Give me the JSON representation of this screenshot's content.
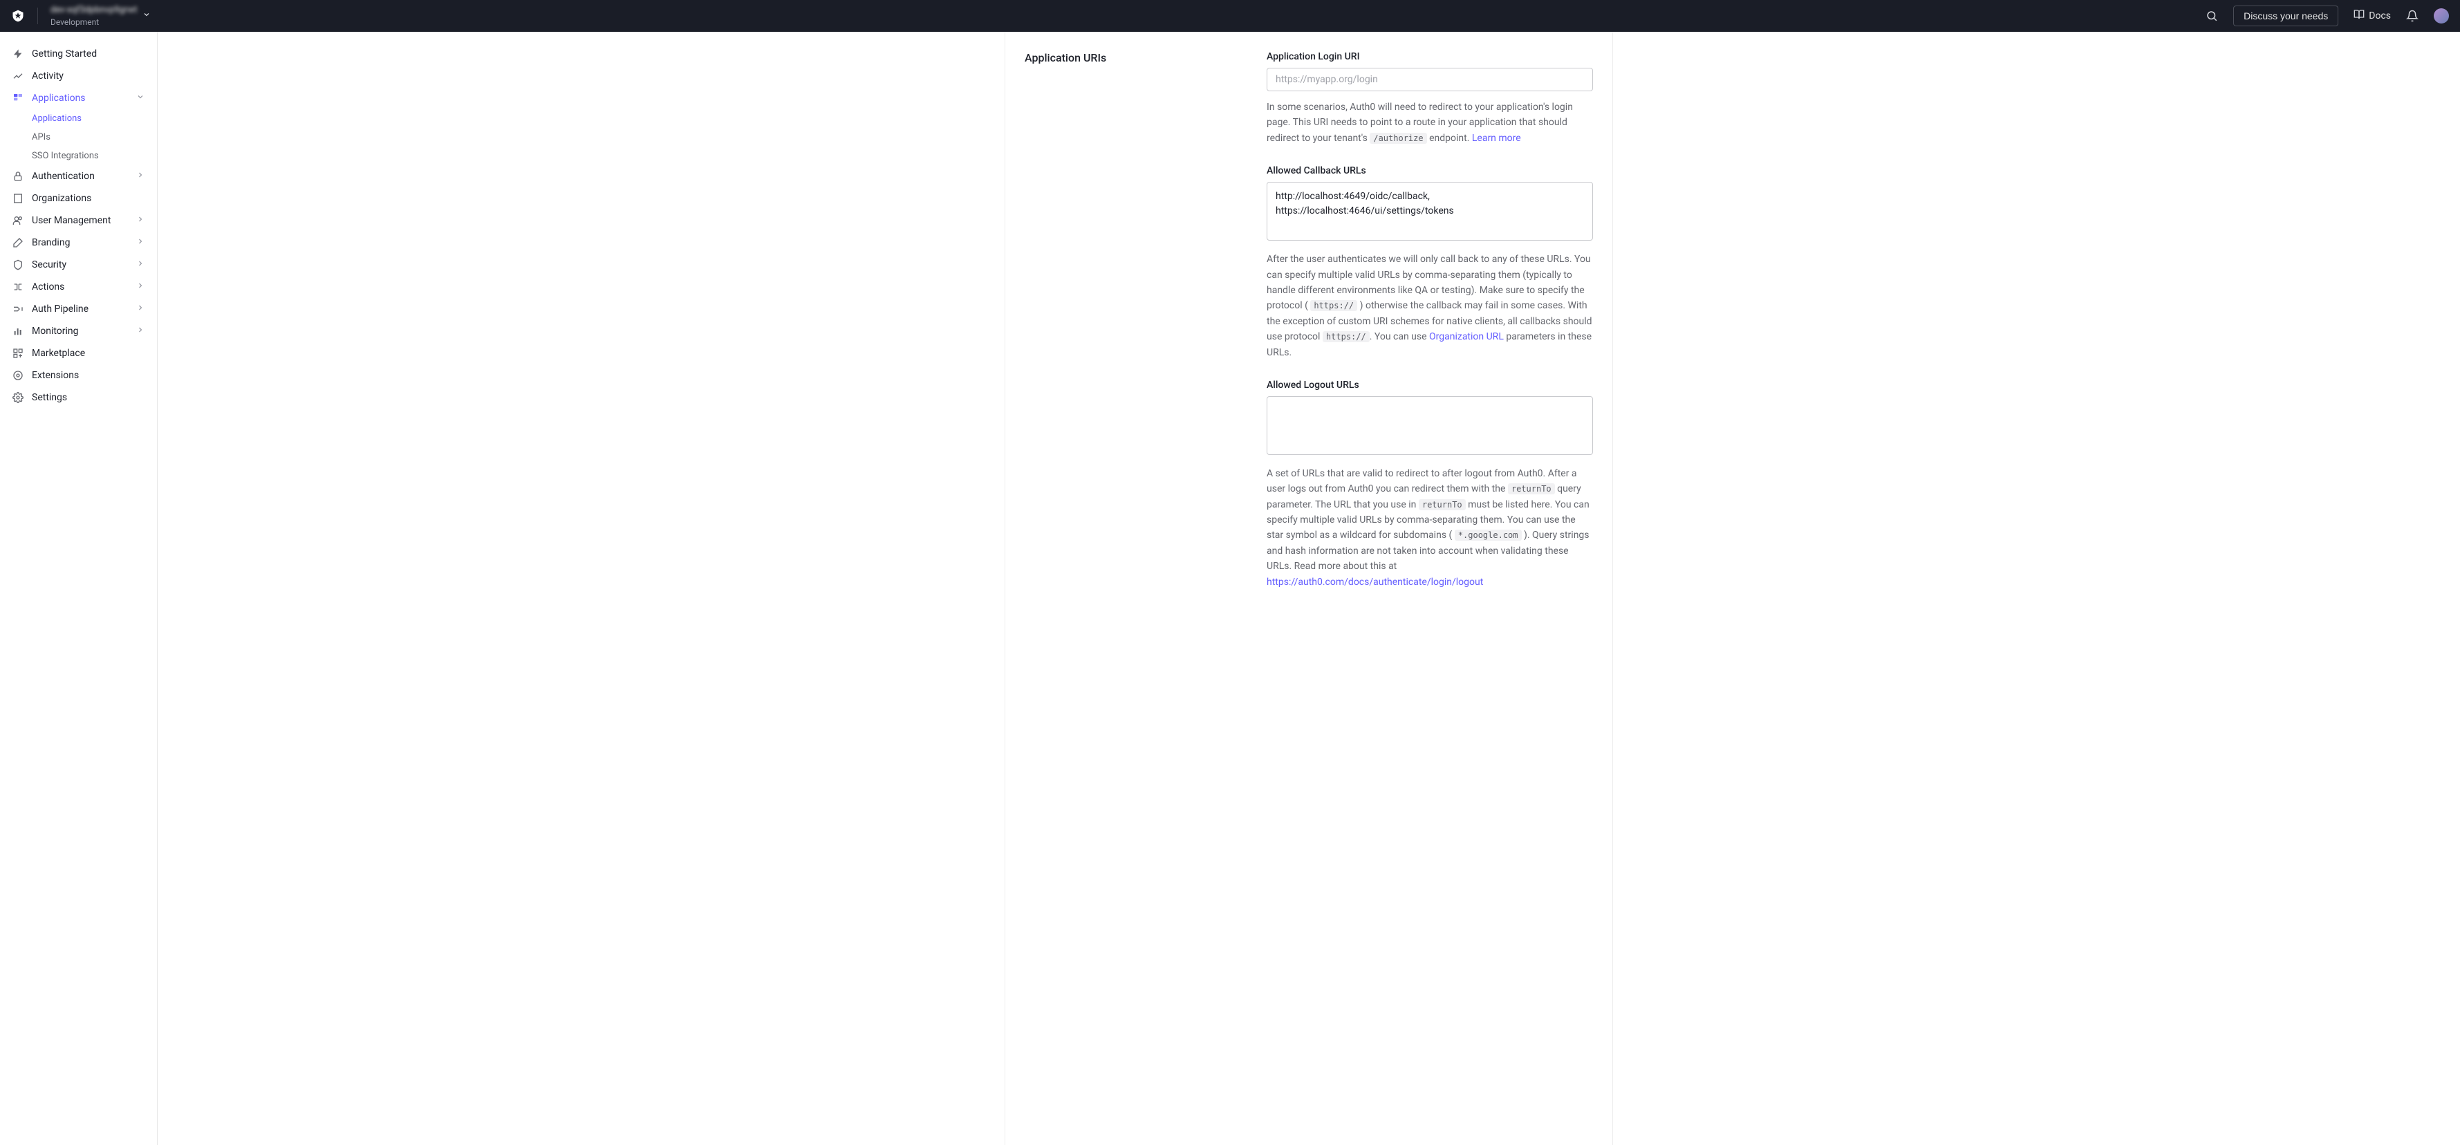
{
  "header": {
    "tenant_name": "dev-xqf3dpbnvp9grwt",
    "tenant_env": "Development",
    "discuss_label": "Discuss your needs",
    "docs_label": "Docs"
  },
  "sidebar": {
    "items": [
      {
        "label": "Getting Started"
      },
      {
        "label": "Activity"
      },
      {
        "label": "Applications"
      },
      {
        "label": "Authentication"
      },
      {
        "label": "Organizations"
      },
      {
        "label": "User Management"
      },
      {
        "label": "Branding"
      },
      {
        "label": "Security"
      },
      {
        "label": "Actions"
      },
      {
        "label": "Auth Pipeline"
      },
      {
        "label": "Monitoring"
      },
      {
        "label": "Marketplace"
      },
      {
        "label": "Extensions"
      },
      {
        "label": "Settings"
      }
    ],
    "sub_items": {
      "applications": "Applications",
      "apis": "APIs",
      "sso": "SSO Integrations"
    }
  },
  "main": {
    "section_title": "Application URIs",
    "login_uri": {
      "label": "Application Login URI",
      "placeholder": "https://myapp.org/login",
      "help_1": "In some scenarios, Auth0 will need to redirect to your application's login page. This URI needs to point to a route in your application that should redirect to your tenant's ",
      "code_1": "/authorize",
      "help_2": " endpoint. ",
      "link_1": "Learn more"
    },
    "callback": {
      "label": "Allowed Callback URLs",
      "value": "http://localhost:4649/oidc/callback,\nhttps://localhost:4646/ui/settings/tokens",
      "help_1": "After the user authenticates we will only call back to any of these URLs. You can specify multiple valid URLs by comma-separating them (typically to handle different environments like QA or testing). Make sure to specify the protocol ( ",
      "code_1": "https://",
      "help_2": " ) otherwise the callback may fail in some cases. With the exception of custom URI schemes for native clients, all callbacks should use protocol ",
      "code_2": "https://",
      "help_3": ". You can use ",
      "link_1": "Organization URL",
      "help_4": " parameters in these URLs."
    },
    "logout": {
      "label": "Allowed Logout URLs",
      "value": "",
      "help_1": "A set of URLs that are valid to redirect to after logout from Auth0. After a user logs out from Auth0 you can redirect them with the ",
      "code_1": "returnTo",
      "help_2": " query parameter. The URL that you use in ",
      "code_2": "returnTo",
      "help_3": " must be listed here. You can specify multiple valid URLs by comma-separating them. You can use the star symbol as a wildcard for subdomains ( ",
      "code_3": "*.google.com",
      "help_4": " ). Query strings and hash information are not taken into account when validating these URLs. Read more about this at ",
      "link_1": "https://auth0.com/docs/authenticate/login/logout"
    }
  }
}
